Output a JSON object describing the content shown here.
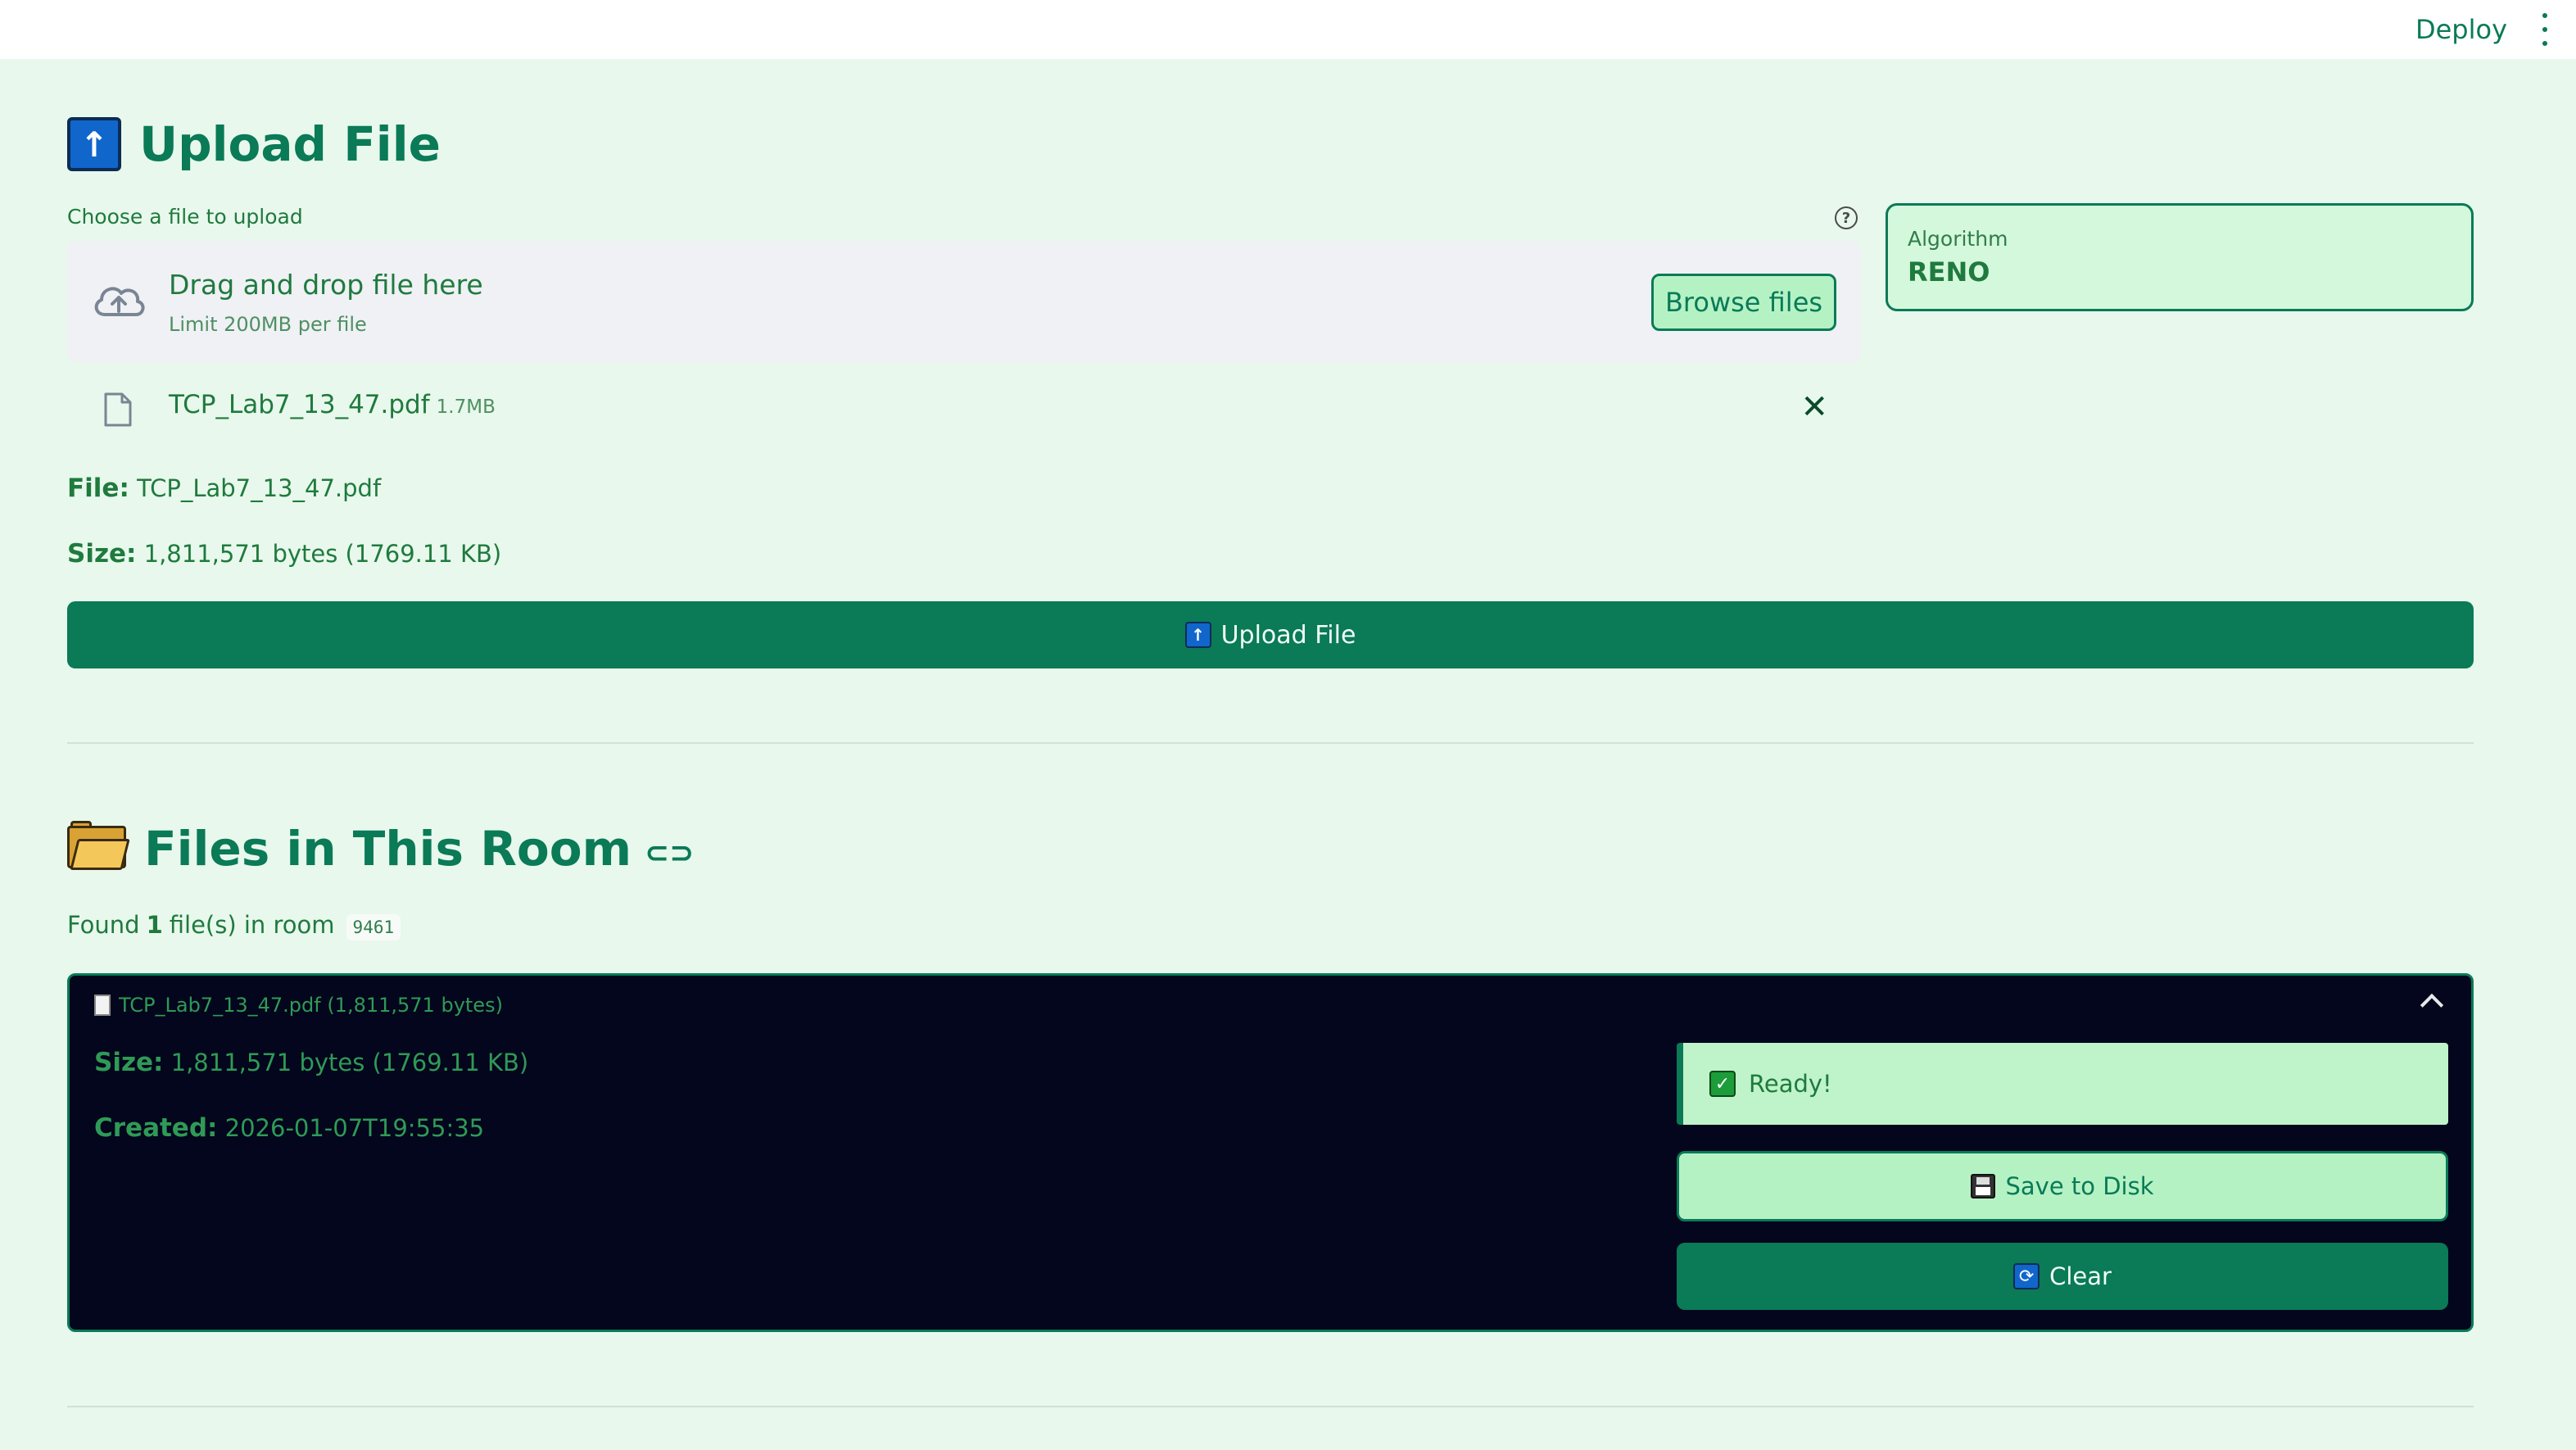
{
  "header": {
    "deploy_label": "Deploy"
  },
  "upload": {
    "title": "Upload File",
    "title_icon": "up-arrow-icon",
    "uploader_label": "Choose a file to upload",
    "dropzone_title": "Drag and drop file here",
    "dropzone_limit": "Limit 200MB per file",
    "browse_label": "Browse files",
    "selected_file": {
      "name": "TCP_Lab7_13_47.pdf",
      "size": "1.7MB"
    },
    "file_label": "File:",
    "file_value": "TCP_Lab7_13_47.pdf",
    "size_label": "Size:",
    "size_value": "1,811,571 bytes (1769.11 KB)",
    "upload_button": "Upload File"
  },
  "algorithm": {
    "label": "Algorithm",
    "value": "RENO"
  },
  "room": {
    "title": "Files in This Room",
    "title_icon": "folder-icon",
    "found_prefix": "Found",
    "found_count": "1",
    "found_suffix": "file(s) in room",
    "room_id": "9461",
    "files": [
      {
        "header": "TCP_Lab7_13_47.pdf (1,811,571 bytes)",
        "size_label": "Size:",
        "size_value": "1,811,571 bytes (1769.11 KB)",
        "created_label": "Created:",
        "created_value": "2026-01-07T19:55:35",
        "status": "Ready!",
        "save_label": "Save to Disk",
        "clear_label": "Clear"
      }
    ]
  },
  "colors": {
    "accent": "#0a7a57",
    "background": "#e8f8ec",
    "expander_bg": "#03061c"
  }
}
